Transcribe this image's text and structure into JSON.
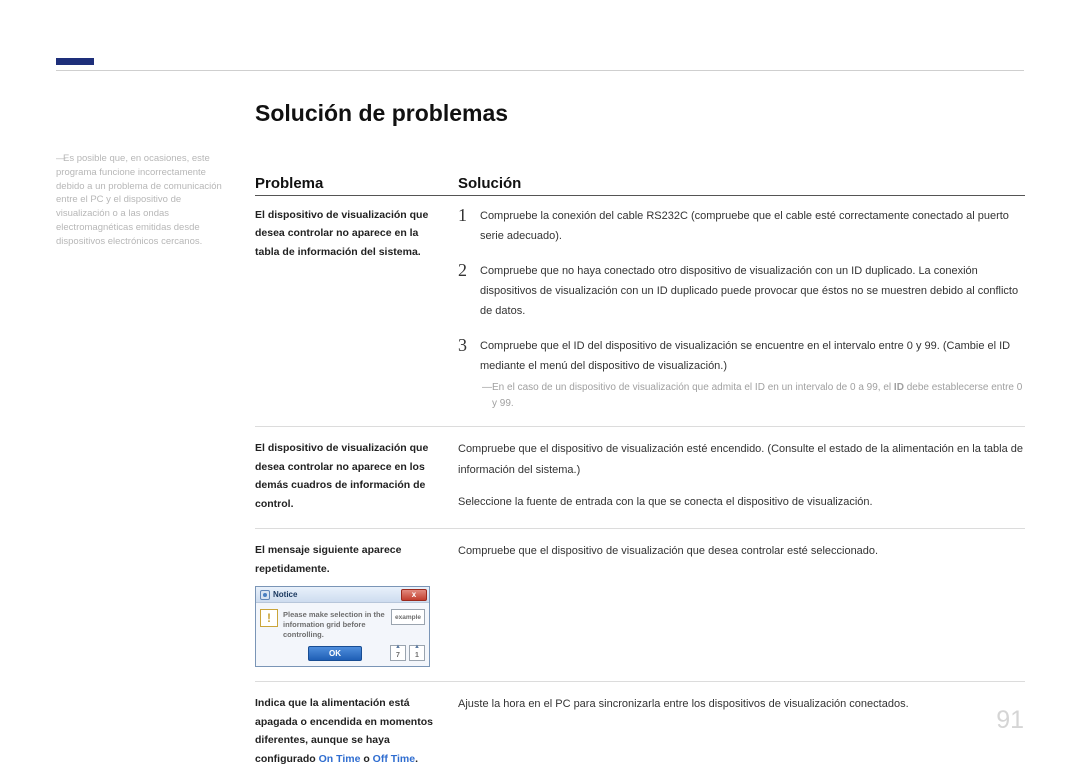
{
  "pageNumber": "91",
  "sidenote": "Es posible que, en ocasiones, este programa funcione incorrectamente debido a un problema de comunicación entre el PC y el dispositivo de visualización o a las ondas electromagnéticas emitidas desde dispositivos electrónicos cercanos.",
  "title": "Solución de problemas",
  "headers": {
    "problema": "Problema",
    "solucion": "Solución"
  },
  "row1": {
    "problem": "El dispositivo de visualización que desea controlar no aparece en la tabla de información del sistema.",
    "steps": [
      "Compruebe la conexión del cable RS232C (compruebe que el cable esté correctamente conectado al puerto serie adecuado).",
      "Compruebe que no haya conectado otro dispositivo de visualización con un ID duplicado. La conexión dispositivos de visualización con un ID duplicado puede provocar que éstos no se muestren debido al conflicto de datos.",
      "Compruebe que el ID del dispositivo de visualización se encuentre en el intervalo entre 0 y 99. (Cambie el ID mediante el menú del dispositivo de visualización.)"
    ],
    "subnote_pre": "En el caso de un dispositivo de visualización que admita el ID en un intervalo de 0 a 99, el ",
    "subnote_bold": "ID",
    "subnote_post": " debe establecerse entre 0 y 99."
  },
  "row2": {
    "problem": "El dispositivo de visualización que desea controlar no aparece en los demás cuadros de información de control.",
    "line1": "Compruebe que el dispositivo de visualización esté encendido. (Consulte el estado de la alimentación en la tabla de información del sistema.)",
    "line2": "Seleccione la fuente de entrada con la que se conecta el dispositivo de visualización."
  },
  "row3": {
    "problem": "El mensaje siguiente aparece repetidamente.",
    "solution": "Compruebe que el dispositivo de visualización que desea controlar esté seleccionado.",
    "dialog": {
      "title": "Notice",
      "msg": "Please make selection in the information grid before controlling.",
      "example": "example",
      "ok": "OK",
      "spin1_top": "▲",
      "spin1_val": "7",
      "spin1_bot": "▼",
      "spin2_top": "▲",
      "spin2_val": "1",
      "spin2_bot": "▼"
    }
  },
  "row4": {
    "problem_pre": "Indica que la alimentación está apagada o encendida en momentos diferentes, aunque se haya configurado ",
    "problem_link1": "On Time",
    "problem_mid": " o ",
    "problem_link2": "Off Time",
    "problem_post": ".",
    "solution": "Ajuste la hora en el PC para sincronizarla entre los dispositivos de visualización conectados."
  }
}
